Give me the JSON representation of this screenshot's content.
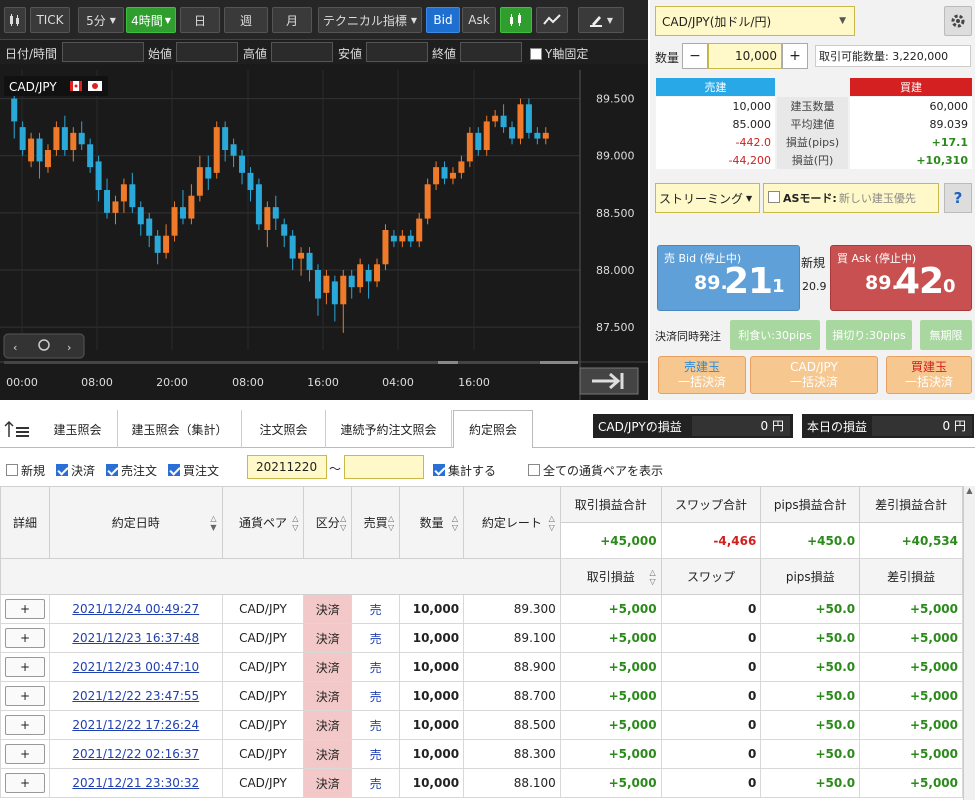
{
  "toolbar": {
    "tick": "TICK",
    "interval1": "5分",
    "interval2": "4時間",
    "day": "日",
    "week": "週",
    "month": "月",
    "tech": "テクニカル指標",
    "bid": "Bid",
    "ask": "Ask"
  },
  "fields": {
    "datetime": "日付/時間",
    "open": "始値",
    "high": "高値",
    "low": "安値",
    "close": "終値",
    "yfix": "Y軸固定"
  },
  "chart": {
    "symbol": "CAD/JPY",
    "y_ticks": [
      "89.500",
      "89.000",
      "88.500",
      "88.000",
      "87.500"
    ],
    "x_ticks": [
      "00:00",
      "08:00",
      "20:00",
      "08:00",
      "16:00",
      "04:00",
      "16:00"
    ],
    "colors": {
      "up": "#ef7a2a",
      "down": "#2aa8d8"
    },
    "candles": [
      [
        89.5,
        89.3,
        89.55,
        89.15
      ],
      [
        89.25,
        89.05,
        89.3,
        89.0
      ],
      [
        88.95,
        89.15,
        89.2,
        88.9
      ],
      [
        89.15,
        88.95,
        89.2,
        88.8
      ],
      [
        88.9,
        89.05,
        89.1,
        88.85
      ],
      [
        89.05,
        89.25,
        89.3,
        89.0
      ],
      [
        89.25,
        89.05,
        89.35,
        89.0
      ],
      [
        89.05,
        89.2,
        89.25,
        88.95
      ],
      [
        89.2,
        89.1,
        89.3,
        89.05
      ],
      [
        89.1,
        88.9,
        89.15,
        88.85
      ],
      [
        88.95,
        88.7,
        89.0,
        88.6
      ],
      [
        88.7,
        88.5,
        88.8,
        88.45
      ],
      [
        88.5,
        88.6,
        88.65,
        88.4
      ],
      [
        88.6,
        88.75,
        88.8,
        88.5
      ],
      [
        88.75,
        88.55,
        88.85,
        88.5
      ],
      [
        88.55,
        88.4,
        88.6,
        88.3
      ],
      [
        88.45,
        88.3,
        88.5,
        88.2
      ],
      [
        88.3,
        88.15,
        88.35,
        88.05
      ],
      [
        88.15,
        88.3,
        88.4,
        88.1
      ],
      [
        88.3,
        88.55,
        88.6,
        88.25
      ],
      [
        88.55,
        88.45,
        88.7,
        88.4
      ],
      [
        88.45,
        88.65,
        88.75,
        88.4
      ],
      [
        88.65,
        88.9,
        89.0,
        88.6
      ],
      [
        88.9,
        88.8,
        89.0,
        88.7
      ],
      [
        88.85,
        89.25,
        89.3,
        88.8
      ],
      [
        89.25,
        89.05,
        89.3,
        88.95
      ],
      [
        89.1,
        89.0,
        89.15,
        88.9
      ],
      [
        89.0,
        88.85,
        89.05,
        88.75
      ],
      [
        88.85,
        88.7,
        88.9,
        88.6
      ],
      [
        88.75,
        88.4,
        88.8,
        88.35
      ],
      [
        88.35,
        88.55,
        88.6,
        88.2
      ],
      [
        88.55,
        88.45,
        88.65,
        88.35
      ],
      [
        88.4,
        88.3,
        88.45,
        88.2
      ],
      [
        88.3,
        88.1,
        88.35,
        88.0
      ],
      [
        88.1,
        88.15,
        88.2,
        87.95
      ],
      [
        88.15,
        88.0,
        88.2,
        87.9
      ],
      [
        88.0,
        87.75,
        88.05,
        87.6
      ],
      [
        87.8,
        87.95,
        88.0,
        87.7
      ],
      [
        87.9,
        87.7,
        87.95,
        87.55
      ],
      [
        87.7,
        87.95,
        88.0,
        87.45
      ],
      [
        87.95,
        87.85,
        88.0,
        87.75
      ],
      [
        87.85,
        88.05,
        88.1,
        87.8
      ],
      [
        88.0,
        87.9,
        88.05,
        87.75
      ],
      [
        87.9,
        88.05,
        88.1,
        87.85
      ],
      [
        88.05,
        88.35,
        88.4,
        88.0
      ],
      [
        88.3,
        88.25,
        88.35,
        88.2
      ],
      [
        88.25,
        88.3,
        88.35,
        88.2
      ],
      [
        88.3,
        88.25,
        88.35,
        88.2
      ],
      [
        88.25,
        88.45,
        88.5,
        88.2
      ],
      [
        88.45,
        88.75,
        88.8,
        88.4
      ],
      [
        88.75,
        88.9,
        88.95,
        88.7
      ],
      [
        88.9,
        88.8,
        88.95,
        88.75
      ],
      [
        88.8,
        88.85,
        88.9,
        88.75
      ],
      [
        88.85,
        88.95,
        89.0,
        88.8
      ],
      [
        88.95,
        89.2,
        89.25,
        88.9
      ],
      [
        89.2,
        89.05,
        89.25,
        89.0
      ],
      [
        89.05,
        89.3,
        89.35,
        89.0
      ],
      [
        89.3,
        89.35,
        89.4,
        89.25
      ],
      [
        89.35,
        89.25,
        89.45,
        89.2
      ],
      [
        89.25,
        89.15,
        89.3,
        89.1
      ],
      [
        89.15,
        89.45,
        89.5,
        89.1
      ],
      [
        89.45,
        89.2,
        89.5,
        89.15
      ],
      [
        89.2,
        89.15,
        89.25,
        89.1
      ],
      [
        89.15,
        89.2,
        89.25,
        89.1
      ]
    ]
  },
  "right": {
    "pair": "CAD/JPY(加ドル/円)",
    "qty_label": "数量",
    "qty_value": "10,000",
    "available": "取引可能数量: 3,220,000",
    "sell_header": "売建",
    "buy_header": "買建",
    "rows": [
      {
        "sell": "10,000",
        "label": "建玉数量",
        "buy": "60,000"
      },
      {
        "sell": "85.000",
        "label": "平均建値",
        "buy": "89.039"
      },
      {
        "sell": "-442.0",
        "label": "損益(pips)",
        "buy": "+17.1"
      },
      {
        "sell": "-44,200",
        "label": "損益(円)",
        "buy": "+10,310"
      }
    ],
    "streaming": "ストリーミング",
    "as_mode": "ASモード:",
    "as_placeholder": "新しい建玉優先",
    "help": "?",
    "bid_label": "売 Bid (停止中)",
    "bid_pre": "89.",
    "bid_big": "21",
    "bid_small": "1",
    "ask_label": "買 Ask (停止中)",
    "ask_pre": "89.",
    "ask_big": "42",
    "ask_small": "0",
    "new": "新規",
    "spread": "20.9",
    "settle_label": "決済同時発注",
    "take_profit": "利食い:30pips",
    "stop_loss": "損切り:30pips",
    "unlimited": "無期限",
    "sell_close": [
      "売建玉",
      "一括決済"
    ],
    "pair_close": [
      "CAD/JPY",
      "一括決済"
    ],
    "buy_close": [
      "買建玉",
      "一括決済"
    ]
  },
  "tabs": [
    "建玉照会",
    "建玉照会（集計）",
    "注文照会",
    "連続予約注文照会",
    "約定照会"
  ],
  "pnl": {
    "pair_label": "CAD/JPYの損益",
    "pair_value": "0 円",
    "today_label": "本日の損益",
    "today_value": "0 円"
  },
  "filters": {
    "new": "新規",
    "settle": "決済",
    "sell": "売注文",
    "buy": "買注文",
    "date_from": "20211220",
    "tilde": "～",
    "aggregate": "集計する",
    "all_pairs": "全ての通貨ペアを表示"
  },
  "table": {
    "headers": {
      "detail": "詳細",
      "datetime": "約定日時",
      "pair": "通貨ペア",
      "kubun": "区分",
      "side": "売買",
      "qty": "数量",
      "rate": "約定レート"
    },
    "sum_headers": [
      "取引損益合計",
      "スワップ合計",
      "pips損益合計",
      "差引損益合計"
    ],
    "sums": [
      "+45,000",
      "-4,466",
      "+450.0",
      "+40,534"
    ],
    "sub_headers": [
      "取引損益",
      "スワップ",
      "pips損益",
      "差引損益"
    ],
    "rows": [
      {
        "dt": "2021/12/24 00:49:27",
        "pair": "CAD/JPY",
        "kubun": "決済",
        "side": "売",
        "qty": "10,000",
        "rate": "89.300",
        "pl": "+5,000",
        "swap": "0",
        "pips": "+50.0",
        "net": "+5,000"
      },
      {
        "dt": "2021/12/23 16:37:48",
        "pair": "CAD/JPY",
        "kubun": "決済",
        "side": "売",
        "qty": "10,000",
        "rate": "89.100",
        "pl": "+5,000",
        "swap": "0",
        "pips": "+50.0",
        "net": "+5,000"
      },
      {
        "dt": "2021/12/23 00:47:10",
        "pair": "CAD/JPY",
        "kubun": "決済",
        "side": "売",
        "qty": "10,000",
        "rate": "88.900",
        "pl": "+5,000",
        "swap": "0",
        "pips": "+50.0",
        "net": "+5,000"
      },
      {
        "dt": "2021/12/22 23:47:55",
        "pair": "CAD/JPY",
        "kubun": "決済",
        "side": "売",
        "qty": "10,000",
        "rate": "88.700",
        "pl": "+5,000",
        "swap": "0",
        "pips": "+50.0",
        "net": "+5,000"
      },
      {
        "dt": "2021/12/22 17:26:24",
        "pair": "CAD/JPY",
        "kubun": "決済",
        "side": "売",
        "qty": "10,000",
        "rate": "88.500",
        "pl": "+5,000",
        "swap": "0",
        "pips": "+50.0",
        "net": "+5,000"
      },
      {
        "dt": "2021/12/22 02:16:37",
        "pair": "CAD/JPY",
        "kubun": "決済",
        "side": "売",
        "qty": "10,000",
        "rate": "88.300",
        "pl": "+5,000",
        "swap": "0",
        "pips": "+50.0",
        "net": "+5,000"
      },
      {
        "dt": "2021/12/21 23:30:32",
        "pair": "CAD/JPY",
        "kubun": "決済",
        "side": "売",
        "qty": "10,000",
        "rate": "88.100",
        "pl": "+5,000",
        "swap": "0",
        "pips": "+50.0",
        "net": "+5,000"
      }
    ]
  }
}
